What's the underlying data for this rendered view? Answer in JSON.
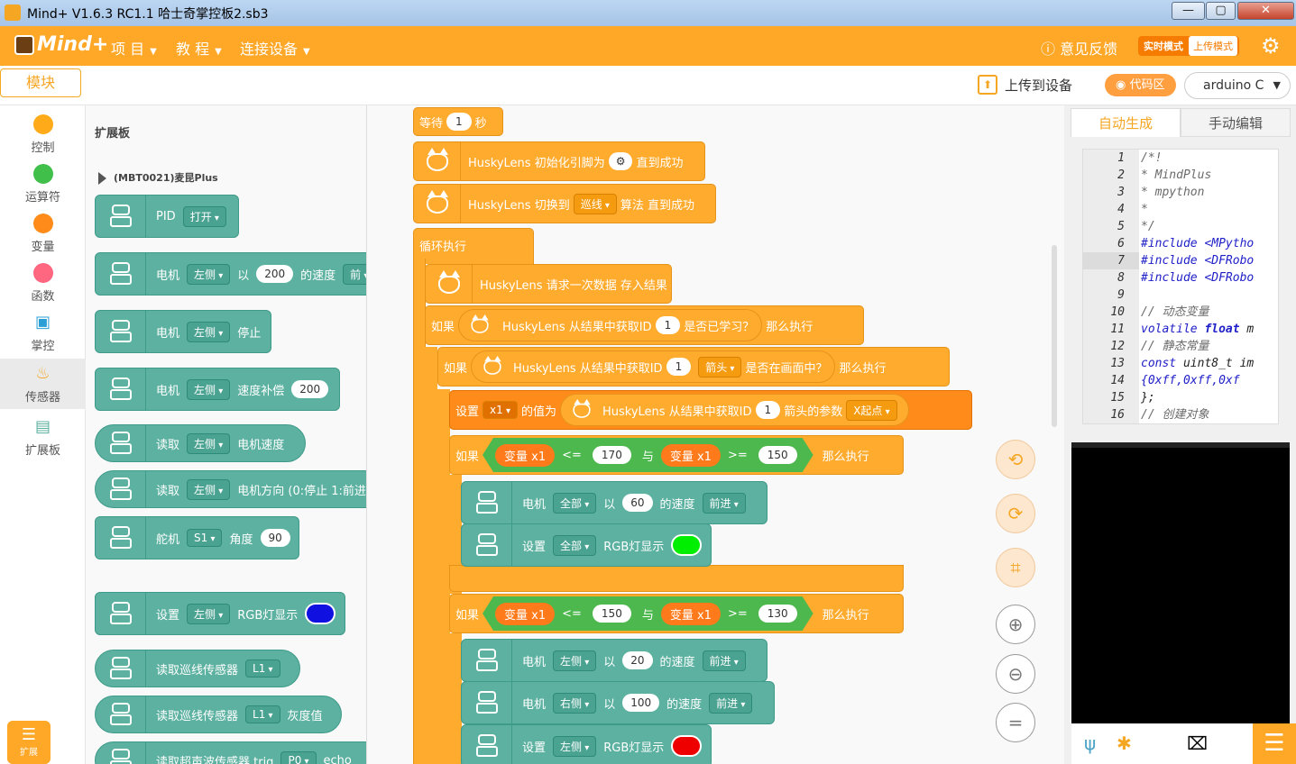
{
  "window": {
    "title": "Mind+ V1.6.3 RC1.1    哈士奇掌控板2.sb3",
    "min": "—",
    "max": "▢",
    "close": "✕"
  },
  "menu": {
    "logo": "Mind+",
    "project": "项 目",
    "tutorial": "教 程",
    "connect": "连接设备",
    "feedback": "意见反馈",
    "realtime": "实时模式",
    "upload_mode": "上传模式"
  },
  "subbar": {
    "module_tab": "模块",
    "upload_device": "上传到设备",
    "code_zone": "代码区",
    "language": "arduino C"
  },
  "categories": [
    {
      "label": "控制",
      "color": "#ffab19"
    },
    {
      "label": "运算符",
      "color": "#40bf4a"
    },
    {
      "label": "变量",
      "color": "#ff8c1a"
    },
    {
      "label": "函数",
      "color": "#ff6680"
    },
    {
      "label": "掌控",
      "color": "#2a9fd6"
    },
    {
      "label": "传感器",
      "color": "#f5a623"
    },
    {
      "label": "扩展板",
      "color": "#5cb1a0"
    }
  ],
  "extend_button": "扩展",
  "palette": {
    "title": "扩展板",
    "sub": "(MBT0021)麦昆Plus",
    "b1": {
      "a": "PID",
      "dd": "打开"
    },
    "b2": {
      "a": "电机",
      "dd": "左侧",
      "b": "以",
      "n": "200",
      "c": "的速度",
      "d": "前"
    },
    "b3": {
      "a": "电机",
      "dd": "左侧",
      "b": "停止"
    },
    "b4": {
      "a": "电机",
      "dd": "左侧",
      "b": "速度补偿",
      "n": "200"
    },
    "b5": {
      "a": "读取",
      "dd": "左侧",
      "b": "电机速度"
    },
    "b6": {
      "a": "读取",
      "dd": "左侧",
      "b": "电机方向 (0:停止 1:前进"
    },
    "b7": {
      "a": "舵机",
      "dd": "S1",
      "b": "角度",
      "n": "90"
    },
    "b8": {
      "a": "设置",
      "dd": "左侧",
      "b": "RGB灯显示",
      "color": "#1010e0"
    },
    "b9": {
      "a": "读取巡线传感器",
      "dd": "L1"
    },
    "b10": {
      "a": "读取巡线传感器",
      "dd": "L1",
      "b": "灰度值"
    },
    "b11": {
      "a": "读取超声波传感器 trig",
      "dd": "P0",
      "b": "echo"
    }
  },
  "ws": {
    "wait": {
      "a": "等待",
      "n": "1",
      "b": "秒"
    },
    "init": {
      "a": "HuskyLens 初始化引脚为",
      "b": "直到成功"
    },
    "switch": {
      "a": "HuskyLens 切换到",
      "dd": "巡线",
      "b": "算法 直到成功"
    },
    "loop": "循环执行",
    "request": "HuskyLens 请求一次数据 存入结果",
    "if1": {
      "a": "如果",
      "b": "HuskyLens 从结果中获取ID",
      "n": "1",
      "c": "是否已学习？",
      "d": "那么执行"
    },
    "if2": {
      "a": "如果",
      "b": "HuskyLens 从结果中获取ID",
      "n": "1",
      "dd": "箭头",
      "c": "是否在画面中？",
      "d": "那么执行"
    },
    "set": {
      "a": "设置",
      "dd": "x1",
      "b": "的值为",
      "c": "HuskyLens 从结果中获取ID",
      "n": "1",
      "d": "箭头的参数",
      "dd2": "X起点"
    },
    "if3": {
      "a": "如果",
      "v1": "变量 x1",
      "op1": "<=",
      "n1": "170",
      "and": "与",
      "v2": "变量 x1",
      "op2": ">=",
      "n2": "150",
      "d": "那么执行"
    },
    "m1": {
      "a": "电机",
      "dd": "全部",
      "b": "以",
      "n": "60",
      "c": "的速度",
      "dd2": "前进"
    },
    "rgb1": {
      "a": "设置",
      "dd": "全部",
      "b": "RGB灯显示",
      "color": "#00ee00"
    },
    "if4": {
      "a": "如果",
      "v1": "变量 x1",
      "op1": "<=",
      "n1": "150",
      "and": "与",
      "v2": "变量 x1",
      "op2": ">=",
      "n2": "130",
      "d": "那么执行"
    },
    "m2": {
      "a": "电机",
      "dd": "左侧",
      "b": "以",
      "n": "20",
      "c": "的速度",
      "dd2": "前进"
    },
    "m3": {
      "a": "电机",
      "dd": "右侧",
      "b": "以",
      "n": "100",
      "c": "的速度",
      "dd2": "前进"
    },
    "rgb2": {
      "a": "设置",
      "dd": "左侧",
      "b": "RGB灯显示",
      "color": "#ee0000"
    }
  },
  "rightpanel": {
    "tab_auto": "自动生成",
    "tab_manual": "手动编辑"
  },
  "code": {
    "lines": [
      "1",
      "2",
      "3",
      "4",
      "5",
      "6",
      "7",
      "8",
      "9",
      "10",
      "11",
      "12",
      "13",
      "14",
      "15",
      "16"
    ],
    "l1": "/*!",
    "l2": " * MindPlus",
    "l3": " * mpython",
    "l4": " *",
    "l5": " */",
    "l6a": "#include ",
    "l6b": "<MPytho",
    "l7a": "#include ",
    "l7b": "<DFRobo",
    "l8a": "#include ",
    "l8b": "<DFRobo",
    "l10": "// 动态变量",
    "l11a": "volatile ",
    "l11b": "float",
    "l11c": " m",
    "l12": "// 静态常量",
    "l13a": "const ",
    "l13b": "uint8_t im",
    "l14": "  {0xff,0xff,0xf",
    "l15": "};",
    "l16": "// 创建对象"
  }
}
